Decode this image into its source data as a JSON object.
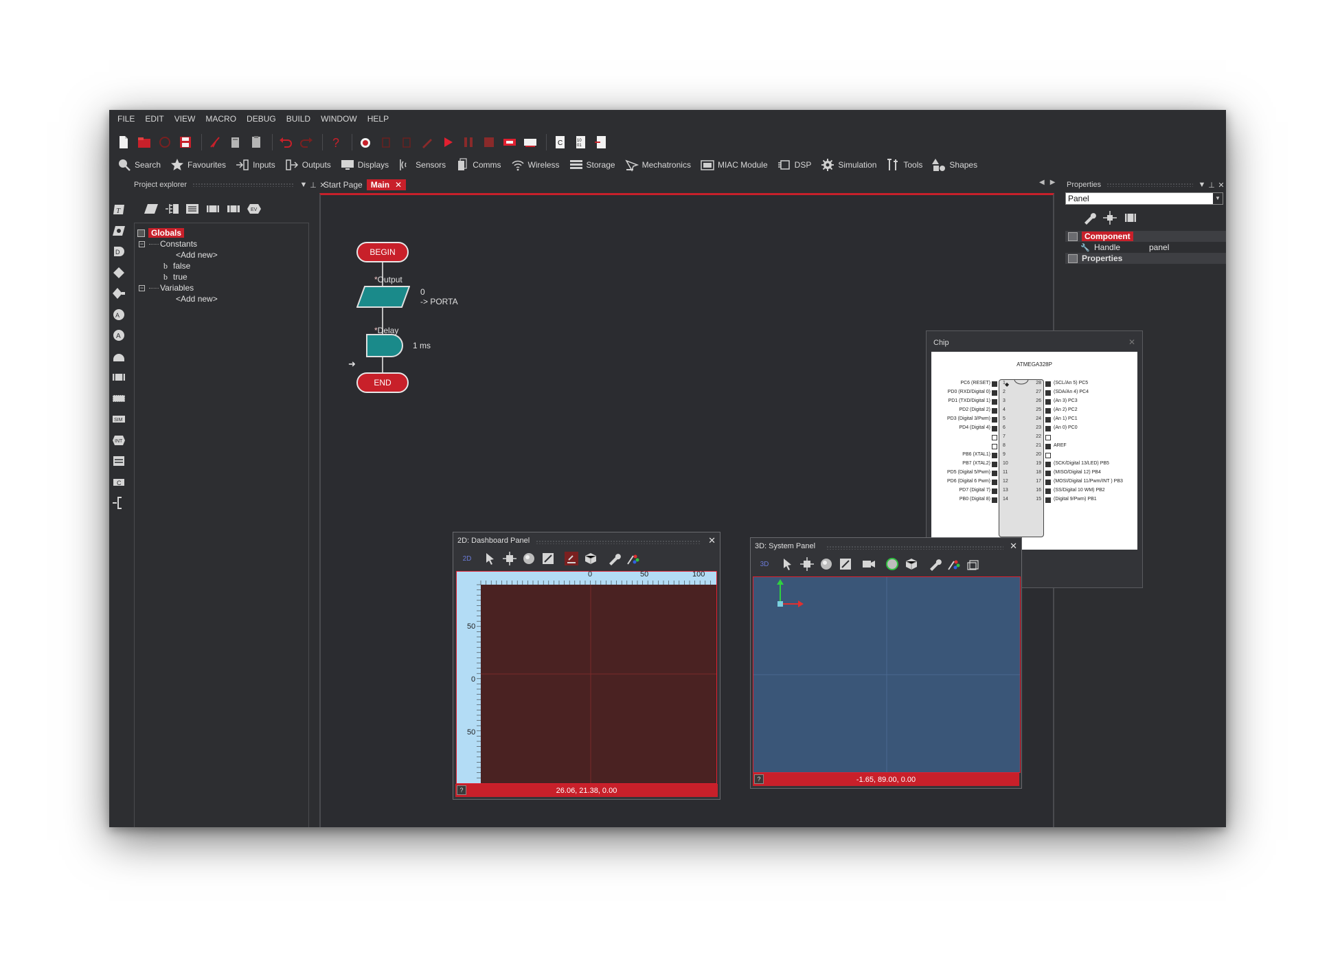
{
  "menu": [
    "FILE",
    "EDIT",
    "VIEW",
    "MACRO",
    "DEBUG",
    "BUILD",
    "WINDOW",
    "HELP"
  ],
  "component_toolbar": [
    {
      "label": "Search",
      "icon": "search-icon"
    },
    {
      "label": "Favourites",
      "icon": "star-icon"
    },
    {
      "label": "Inputs",
      "icon": "inputs-icon"
    },
    {
      "label": "Outputs",
      "icon": "outputs-icon"
    },
    {
      "label": "Displays",
      "icon": "display-icon"
    },
    {
      "label": "Sensors",
      "icon": "sensors-icon"
    },
    {
      "label": "Comms",
      "icon": "comms-icon"
    },
    {
      "label": "Wireless",
      "icon": "wireless-icon"
    },
    {
      "label": "Storage",
      "icon": "storage-icon"
    },
    {
      "label": "Mechatronics",
      "icon": "mechatronics-icon"
    },
    {
      "label": "MIAC Module",
      "icon": "miac-icon"
    },
    {
      "label": "DSP",
      "icon": "dsp-icon"
    },
    {
      "label": "Simulation",
      "icon": "gear-icon"
    },
    {
      "label": "Tools",
      "icon": "tools-icon"
    },
    {
      "label": "Shapes",
      "icon": "shapes-icon"
    }
  ],
  "project_explorer": {
    "title": "Project explorer",
    "root": "Globals",
    "constants_label": "Constants",
    "constants": [
      "<Add new>",
      "false",
      "true"
    ],
    "variables_label": "Variables",
    "variables": [
      "<Add new>"
    ]
  },
  "tabs": [
    {
      "label": "Start Page",
      "active": false
    },
    {
      "label": "Main",
      "active": true
    }
  ],
  "flowchart": {
    "begin": "BEGIN",
    "output_name": "Output",
    "output_value": "0",
    "output_target": "-> PORTA",
    "delay_name": "Delay",
    "delay_value": "1 ms",
    "end": "END"
  },
  "chip": {
    "title": "Chip",
    "name": "ATMEGA328P",
    "left_pins": [
      {
        "num": "1",
        "label": "PC6 (RESET)"
      },
      {
        "num": "2",
        "label": "PD0 (RXD/Digital 0)"
      },
      {
        "num": "3",
        "label": "PD1 (TXD/Digital 1)"
      },
      {
        "num": "4",
        "label": "PD2 (Digital 2)"
      },
      {
        "num": "5",
        "label": "PD3 (Digital 3/Pwm)"
      },
      {
        "num": "6",
        "label": "PD4 (Digital 4)"
      },
      {
        "num": "7",
        "label": ""
      },
      {
        "num": "8",
        "label": ""
      },
      {
        "num": "9",
        "label": "PB6 (XTAL1)"
      },
      {
        "num": "10",
        "label": "PB7 (XTAL2)"
      },
      {
        "num": "11",
        "label": "PD5 (Digital 5/Pwm)"
      },
      {
        "num": "12",
        "label": "PD6 (Digital 6 Pwm)"
      },
      {
        "num": "13",
        "label": "PD7 (Digital 7)"
      },
      {
        "num": "14",
        "label": "PB0 (Digital 8)"
      }
    ],
    "right_pins": [
      {
        "num": "28",
        "label": "(SCL/An 5) PC5"
      },
      {
        "num": "27",
        "label": "(SDA/An 4) PC4"
      },
      {
        "num": "26",
        "label": "(An 3) PC3"
      },
      {
        "num": "25",
        "label": "(An 2) PC2"
      },
      {
        "num": "24",
        "label": "(An 1) PC1"
      },
      {
        "num": "23",
        "label": "(An 0) PC0"
      },
      {
        "num": "22",
        "label": ""
      },
      {
        "num": "21",
        "label": "AREF"
      },
      {
        "num": "20",
        "label": ""
      },
      {
        "num": "19",
        "label": "(SCK/Digital 13/LED) PB5"
      },
      {
        "num": "18",
        "label": "(MISO/Digital 12) PB4"
      },
      {
        "num": "17",
        "label": "(MOSI/Digital 11/Pwm/INT ) PB3"
      },
      {
        "num": "16",
        "label": "(SS/Digital 10 WM) PB2"
      },
      {
        "num": "15",
        "label": "(Digital 9/Pwm) PB1"
      }
    ]
  },
  "dashboard_panel": {
    "title": "2D: Dashboard Panel",
    "mode": "2D",
    "ruler_top": [
      "0",
      "50",
      "100"
    ],
    "ruler_left": [
      "50",
      "0",
      "50"
    ],
    "status": "26.06, 21.38, 0.00"
  },
  "system_panel": {
    "title": "3D: System Panel",
    "mode": "3D",
    "status": "-1.65, 89.00, 0.00"
  },
  "properties": {
    "title": "Properties",
    "selected": "Panel",
    "component_label": "Component",
    "handle_label": "Handle",
    "handle_value": "panel",
    "properties_label": "Properties"
  },
  "colors": {
    "accent": "#c8202a",
    "background": "#2d2e31",
    "teal": "#1a8a8a",
    "dashboard_bg": "#4a2222",
    "system_bg": "#3a5678",
    "ruler": "#b3dcf5"
  }
}
